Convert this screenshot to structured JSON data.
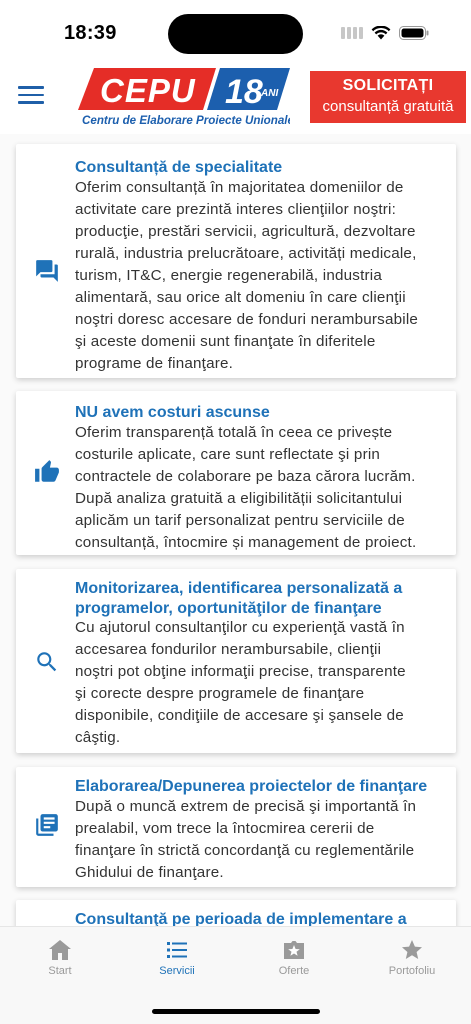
{
  "status_bar": {
    "time": "18:39"
  },
  "header": {
    "logo_main": "CEPU",
    "logo_years": "18",
    "logo_years_unit": "ANI",
    "logo_subtitle": "Centru de Elaborare Proiecte Unionale",
    "cta_line1": "SOLICITAȚI",
    "cta_line2": "consultanță gratuită"
  },
  "cards": [
    {
      "icon": "chat-icon",
      "title": "Consultanță de specialitate",
      "text_lines": [
        "Oferim consultanță în majoritatea domeniilor de",
        "activitate care prezintă interes clienţiilor noştri:",
        "producţie, prestări servicii, agricultură, dezvoltare",
        "rurală, industria prelucrătoare, activități medicale,",
        "turism,  IT&C, energie regenerabilă, industria",
        "alimentară, sau orice alt domeniu în care clienţii",
        "noştri doresc accesare de fonduri nerambursabile",
        "şi aceste domenii sunt finanţate în diferitele",
        "programe de finanţare."
      ]
    },
    {
      "icon": "thumbs-up-icon",
      "title": "NU avem costuri ascunse",
      "text_lines": [
        "Oferim transparență totală în ceea ce privește",
        "costurile aplicate, care sunt reflectate şi prin",
        "contractele de colaborare pe baza cărora lucrăm.",
        "După analiza gratuită a eligibilității solicitantului",
        "aplicăm un tarif personalizat pentru serviciile de",
        "consultanță, întocmire și management de proiect."
      ]
    },
    {
      "icon": "search-icon",
      "title_lines": [
        "Monitorizarea, identificarea personalizată a",
        "programelor, oportunităţilor de finanţare"
      ],
      "text_lines": [
        "Cu ajutorul consultanţilor cu experienţă vastă în",
        "accesarea fondurilor nerambursabile, clienţii",
        "noştri pot obţine informaţii precise, transparente",
        "şi corecte despre programele de finanţare",
        "disponibile, condiţiile de accesare şi şansele de",
        "câştig."
      ]
    },
    {
      "icon": "document-list-icon",
      "title": "Elaborarea/Depunerea proiectelor de finanţare",
      "text_lines": [
        "După o muncă extrem de precisă şi importantă în",
        "prealabil, vom trece la întocmirea cererii de",
        "finanţare în strictă concordanţă cu reglementările",
        "Ghidului de finanţare."
      ]
    },
    {
      "title": "Consultanţă pe perioada de implementare a"
    }
  ],
  "tabs": [
    {
      "icon": "home-icon",
      "label": "Start"
    },
    {
      "icon": "list-icon",
      "label": "Servicii"
    },
    {
      "icon": "badge-star-icon",
      "label": "Oferte"
    },
    {
      "icon": "star-icon",
      "label": "Portofoliu"
    }
  ],
  "colors": {
    "accent": "#1f72b8",
    "cta": "#e8382f",
    "logo_red": "#e52d27",
    "logo_blue": "#1c5fae"
  }
}
